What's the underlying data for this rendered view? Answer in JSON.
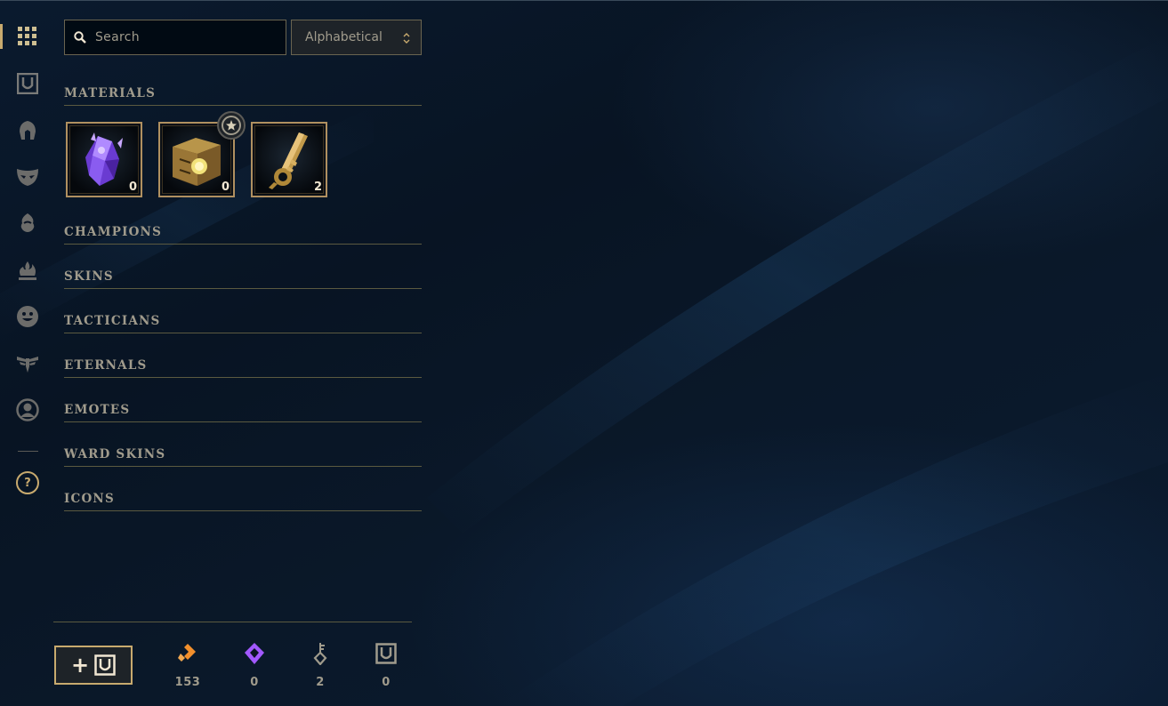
{
  "search": {
    "placeholder": "Search"
  },
  "sort": {
    "selected": "Alphabetical"
  },
  "rail": {
    "items": [
      {
        "icon": "grid-icon",
        "active": true
      },
      {
        "icon": "chest-icon"
      },
      {
        "icon": "champion-helmet-icon"
      },
      {
        "icon": "skin-mask-icon"
      },
      {
        "icon": "tactician-icon"
      },
      {
        "icon": "eternals-flame-icon"
      },
      {
        "icon": "emote-smiley-icon"
      },
      {
        "icon": "ward-icon"
      },
      {
        "icon": "profile-icon"
      }
    ],
    "help_label": "?"
  },
  "sections": {
    "materials": "MATERIALS",
    "champions": "CHAMPIONS",
    "skins": "SKINS",
    "tacticians": "TACTICIANS",
    "eternals": "ETERNALS",
    "emotes": "EMOTES",
    "ward_skins": "WARD SKINS",
    "icons": "ICONS"
  },
  "materials": [
    {
      "icon": "gemstone-icon",
      "count": "0"
    },
    {
      "icon": "masterwork-chest-icon",
      "count": "0"
    },
    {
      "icon": "hextech-key-icon",
      "count": "2"
    }
  ],
  "currencies": [
    {
      "icon": "blue-essence-icon",
      "value": "153",
      "color": "#f28f2c"
    },
    {
      "icon": "mythic-essence-icon",
      "value": "0",
      "color": "#a259ff"
    },
    {
      "icon": "key-fragment-icon",
      "value": "2",
      "color": "#a09b8c"
    },
    {
      "icon": "chest-currency-icon",
      "value": "0",
      "color": "#a09b8c"
    }
  ],
  "colors": {
    "gold": "#c8aa6e",
    "text": "#a09b8c",
    "background": "#091428"
  }
}
